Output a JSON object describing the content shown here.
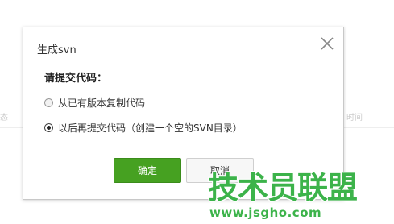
{
  "dialog": {
    "title": "生成svn",
    "close_icon": "close-icon",
    "section_label": "请提交代码：",
    "options": [
      {
        "label": "从已有版本复制代码",
        "checked": false
      },
      {
        "label": "以后再提交代码（创建一个空的SVN目录）",
        "checked": true
      }
    ],
    "ok_label": "确定",
    "cancel_label": "取消"
  },
  "background": {
    "left_fragment": "态",
    "right_fragment": "时间"
  },
  "watermark": {
    "brand": "技术员联盟",
    "url": "www.jsgho.com"
  },
  "colors": {
    "accent_green": "#46a121",
    "watermark_green": "#3cb34a"
  }
}
